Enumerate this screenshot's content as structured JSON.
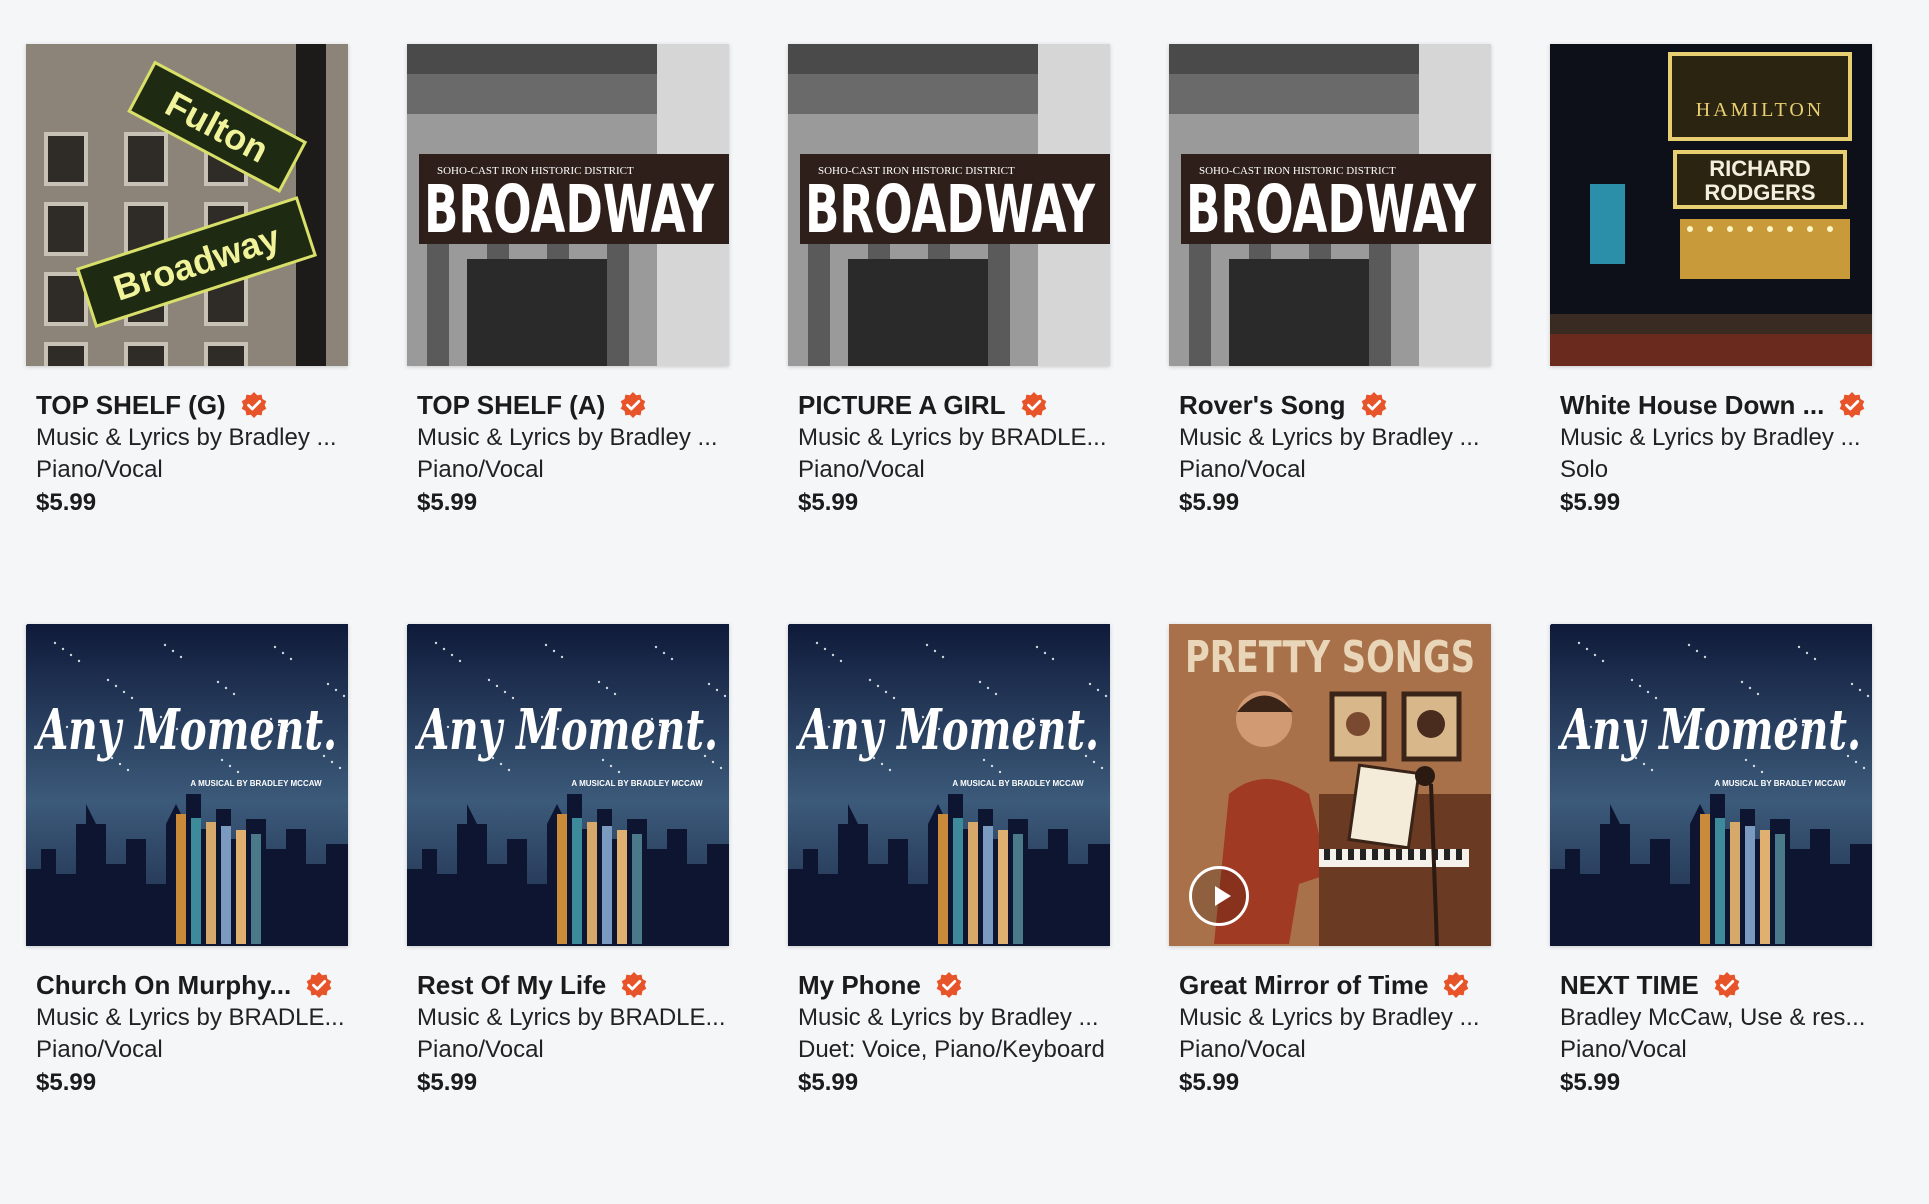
{
  "accent_color": "#e8542a",
  "items": [
    {
      "title": "TOP SHELF (G)",
      "credit": "Music & Lyrics by Bradley ...",
      "arrangement": "Piano/Vocal",
      "price": "$5.99",
      "art": "fulton",
      "sign_text": "Broadway"
    },
    {
      "title": "TOP SHELF (A)",
      "credit": "Music & Lyrics by Bradley ...",
      "arrangement": "Piano/Vocal",
      "price": "$5.99",
      "art": "broadway",
      "sign_small": "SOHO-CAST IRON HISTORIC DISTRICT",
      "sign_text": "BROADWAY"
    },
    {
      "title": "PICTURE A GIRL",
      "credit": "Music & Lyrics by BRADLE...",
      "arrangement": "Piano/Vocal",
      "price": "$5.99",
      "art": "broadway",
      "sign_small": "SOHO-CAST IRON HISTORIC DISTRICT",
      "sign_text": "BROADWAY"
    },
    {
      "title": "Rover's Song",
      "credit": "Music & Lyrics by Bradley ...",
      "arrangement": "Piano/Vocal",
      "price": "$5.99",
      "art": "broadway",
      "sign_small": "SOHO-CAST IRON HISTORIC DISTRICT",
      "sign_text": "BROADWAY"
    },
    {
      "title": "White House Down ...",
      "credit": "Music & Lyrics by Bradley ...",
      "arrangement": "Solo",
      "price": "$5.99",
      "art": "hamilton",
      "sign_text": "HAMILTON",
      "sign_small": "RICHARD RODGERS"
    },
    {
      "title": "Church On Murphy...",
      "credit": "Music & Lyrics by BRADLE...",
      "arrangement": "Piano/Vocal",
      "price": "$5.99",
      "art": "anymoment",
      "sign_text": "Any Moment.",
      "sign_small": "A MUSICAL BY BRADLEY MCCAW"
    },
    {
      "title": "Rest Of My Life",
      "credit": "Music & Lyrics by BRADLE...",
      "arrangement": "Piano/Vocal",
      "price": "$5.99",
      "art": "anymoment",
      "sign_text": "Any Moment.",
      "sign_small": "A MUSICAL BY BRADLEY MCCAW"
    },
    {
      "title": "My Phone",
      "credit": "Music & Lyrics by Bradley ...",
      "arrangement": "Duet: Voice, Piano/Keyboard",
      "price": "$5.99",
      "art": "anymoment",
      "sign_text": "Any Moment.",
      "sign_small": "A MUSICAL BY BRADLEY MCCAW"
    },
    {
      "title": "Great Mirror of Time",
      "credit": "Music & Lyrics by Bradley ...",
      "arrangement": "Piano/Vocal",
      "price": "$5.99",
      "art": "pretty",
      "sign_text": "PRETTY SONGS",
      "has_play": true
    },
    {
      "title": "NEXT TIME",
      "credit": "Bradley McCaw, Use & res...",
      "arrangement": "Piano/Vocal",
      "price": "$5.99",
      "art": "anymoment",
      "sign_text": "Any Moment.",
      "sign_small": "A MUSICAL BY BRADLEY MCCAW"
    }
  ]
}
